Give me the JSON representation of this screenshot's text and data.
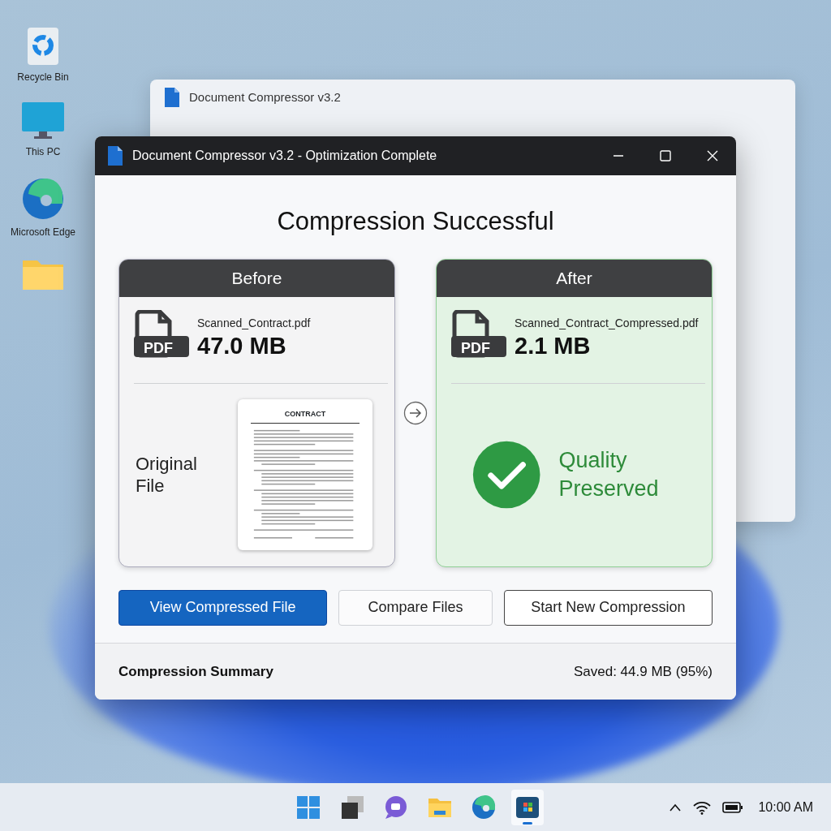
{
  "desktop_icons": [
    {
      "kind": "recycle",
      "label": "Recycle Bin"
    },
    {
      "kind": "pc",
      "label": "This PC"
    },
    {
      "kind": "edge",
      "label": "Microsoft Edge"
    },
    {
      "kind": "folder"
    }
  ],
  "background_window": {
    "title": "Document Compressor v3.2"
  },
  "window": {
    "title": "Document Compressor v3.2 - Optimization Complete",
    "heading": "Compression Successful",
    "panels": [
      {
        "kind": "before",
        "header": "Before",
        "file_type": "PDF",
        "file_name": "Scanned_Contract.pdf",
        "size": "47.0 MB",
        "caption": "Original File",
        "preview_title": "CONTRACT"
      },
      {
        "kind": "after",
        "header": "After",
        "file_type": "PDF",
        "file_name": "Scanned_Contract_Compressed.pdf",
        "size": "2.1 MB",
        "status": "Quality Preserved"
      }
    ],
    "buttons": [
      {
        "kind": "primary",
        "label": "View Compressed File"
      },
      {
        "kind": "secondary",
        "label": "Compare Files"
      },
      {
        "kind": "outline",
        "label": "Start New Compression"
      }
    ],
    "summary": {
      "label": "Compression Summary",
      "value": "Saved: 44.9 MB (95%)"
    }
  },
  "taskbar": {
    "apps": [
      {
        "kind": "start",
        "selected": false
      },
      {
        "kind": "taskview",
        "selected": false
      },
      {
        "kind": "chat",
        "selected": false
      },
      {
        "kind": "folder",
        "selected": false
      },
      {
        "kind": "edge",
        "selected": false
      },
      {
        "kind": "compressor",
        "selected": true
      }
    ],
    "time": "10:00 AM"
  }
}
